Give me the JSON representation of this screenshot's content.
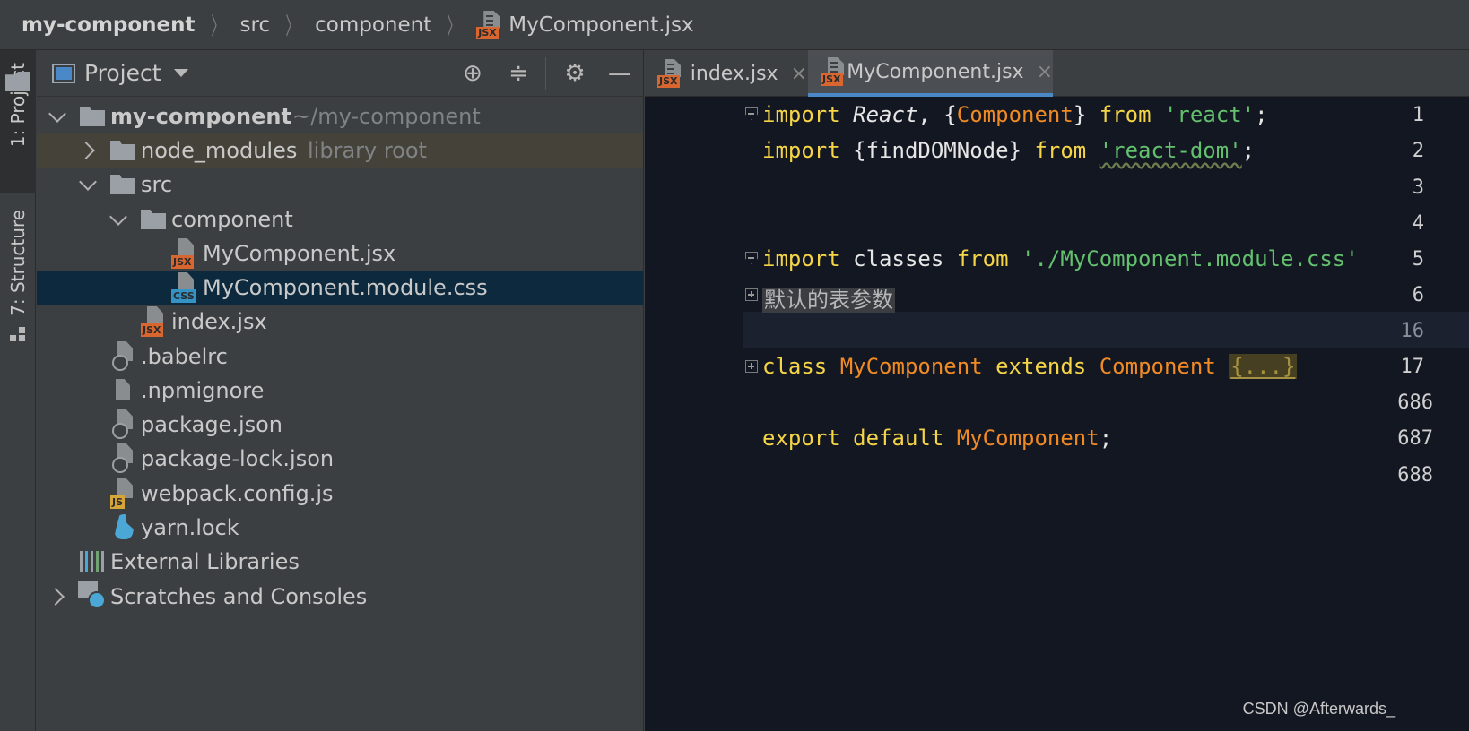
{
  "breadcrumb": {
    "items": [
      "my-component",
      "src",
      "component",
      "MyComponent.jsx"
    ],
    "file_tag": "JSX"
  },
  "toolstrip": {
    "project_tab": "1: Project",
    "structure_tab": "7: Structure"
  },
  "project_panel": {
    "title": "Project",
    "tree": {
      "root_name": "my-component",
      "root_path": "~/my-component",
      "node_modules": "node_modules",
      "node_modules_hint": "library root",
      "src": "src",
      "component": "component",
      "mycomponent_jsx": "MyComponent.jsx",
      "mycomponent_css": "MyComponent.module.css",
      "index_jsx": "index.jsx",
      "babelrc": ".babelrc",
      "npmignore": ".npmignore",
      "package_json": "package.json",
      "package_lock": "package-lock.json",
      "webpack": "webpack.config.js",
      "yarn": "yarn.lock",
      "external": "External Libraries",
      "scratches": "Scratches and Consoles"
    },
    "tags": {
      "jsx": "JSX",
      "css": "CSS",
      "js": "JS"
    }
  },
  "editor": {
    "tabs": [
      {
        "label": "index.jsx",
        "tag": "JSX",
        "active": false
      },
      {
        "label": "MyComponent.jsx",
        "tag": "JSX",
        "active": true
      }
    ],
    "close_glyph": "×",
    "line_numbers": [
      "1",
      "2",
      "3",
      "4",
      "5",
      "6",
      "16",
      "17",
      "686",
      "687",
      "688"
    ],
    "code": {
      "l1": {
        "kw": "import",
        "react": "React",
        "comma": ", {",
        "comp": "Component",
        "close": "} ",
        "from": "from",
        "str": "'react'",
        "end": ";"
      },
      "l2": {
        "kw": "import",
        "mid": " {findDOMNode} ",
        "from": "from",
        "str": "'react-dom'",
        "end": ";"
      },
      "l5": {
        "kw": "import",
        "mid": " classes ",
        "from": "from",
        "str": "'./MyComponent.module.css'"
      },
      "l6": {
        "folded": "默认的表参数"
      },
      "l17": {
        "kw": "class",
        "name": "MyComponent",
        "ext": "extends",
        "base": "Component",
        "collapsed": "{...}"
      },
      "l687": {
        "kw": "export",
        "kw2": "default",
        "name": "MyComponent",
        "end": ";"
      }
    }
  },
  "watermark": "CSDN @Afterwards_",
  "colors": {
    "keyword": "#f5d547",
    "type": "#f08a24",
    "string": "#63c16e",
    "editor_bg": "#131722",
    "selection": "#0d293e",
    "accent": "#4a88c7"
  }
}
